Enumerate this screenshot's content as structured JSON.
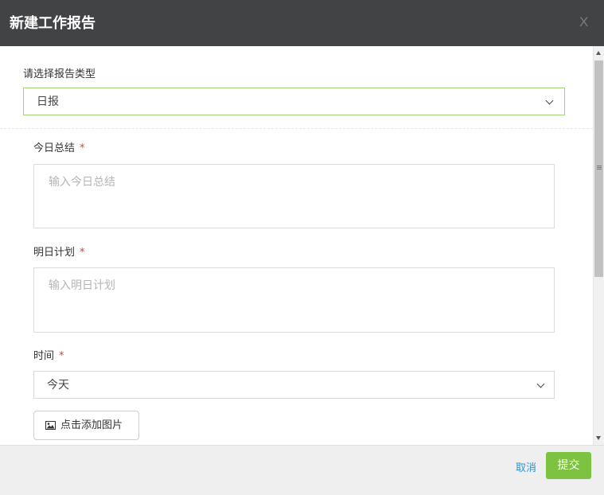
{
  "dialog": {
    "title": "新建工作报告",
    "close_label": "X"
  },
  "report_type": {
    "label": "请选择报告类型",
    "selected": "日报"
  },
  "today_summary": {
    "label": "今日总结",
    "required_mark": "*",
    "placeholder": "输入今日总结"
  },
  "tomorrow_plan": {
    "label": "明日计划",
    "required_mark": "*",
    "placeholder": "输入明日计划"
  },
  "time": {
    "label": "时间",
    "required_mark": "*",
    "selected": "今天"
  },
  "add_image": {
    "label": "点击添加图片",
    "icon": "image-icon"
  },
  "footer": {
    "cancel_label": "取消",
    "submit_label": "提交"
  },
  "colors": {
    "header_bg": "#424345",
    "accent_green": "#7ec241",
    "link_blue": "#2d95d6",
    "required_red": "#d9442c"
  }
}
